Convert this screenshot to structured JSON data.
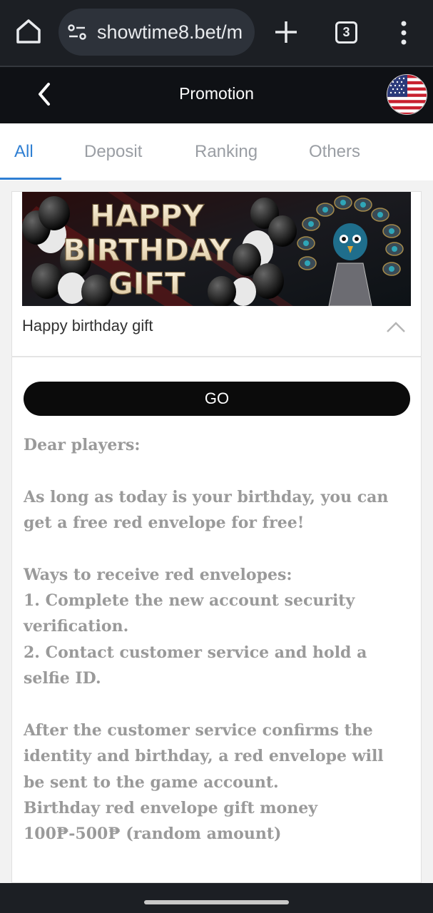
{
  "browser": {
    "url": "showtime8.bet/m",
    "tab_count": "3"
  },
  "header": {
    "title": "Promotion"
  },
  "tabs": [
    {
      "label": "All"
    },
    {
      "label": "Deposit"
    },
    {
      "label": "Ranking"
    },
    {
      "label": "Others"
    }
  ],
  "promo": {
    "banner_lines": [
      "HAPPY",
      "BIRTHDAY",
      "GIFT"
    ],
    "title": "Happy birthday gift",
    "go_label": "GO",
    "description": {
      "greeting": "Dear players:",
      "p1_l1": "As long as today is your birthday, you can",
      "p1_l2": "get a free red envelope for free!",
      "ways_heading": "Ways to receive red envelopes:",
      "way1_l1": "1. Complete the new account security",
      "way1_l2": "verification.",
      "way2_l1": "2. Contact customer service and hold a",
      "way2_l2": "selfie ID.",
      "p3_l1": "After the customer service confirms the",
      "p3_l2": "identity and birthday, a red envelope will",
      "p3_l3": "be sent to the game account.",
      "p4_l1": "Birthday red envelope gift money",
      "p4_l2": "100₱-500₱ (random amount)"
    }
  },
  "colors": {
    "accent": "#2f7fd3",
    "header_bg": "#0f1115",
    "text_muted": "#9a9a9a"
  }
}
